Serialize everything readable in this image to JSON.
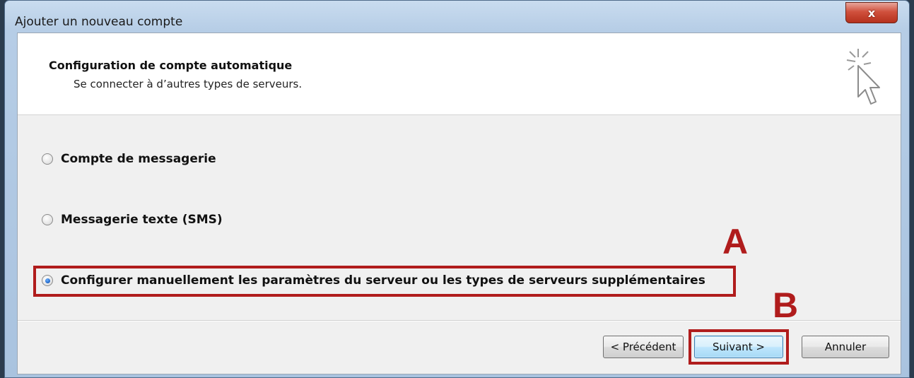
{
  "window": {
    "title": "Ajouter un nouveau compte",
    "close_label": "x"
  },
  "header": {
    "title": "Configuration de compte automatique",
    "subtitle": "Se connecter à d’autres types de serveurs.",
    "icon": "cursor-sparkle-icon"
  },
  "options": [
    {
      "label": "Compte de messagerie",
      "selected": false
    },
    {
      "label": "Messagerie texte (SMS)",
      "selected": false
    },
    {
      "label": "Configurer manuellement les paramètres du serveur ou les types de serveurs supplémentaires",
      "selected": true
    }
  ],
  "annotations": {
    "a": "A",
    "b": "B",
    "color": "#b01c1c"
  },
  "buttons": {
    "back": "< Précédent",
    "next": "Suivant >",
    "cancel": "Annuler"
  }
}
